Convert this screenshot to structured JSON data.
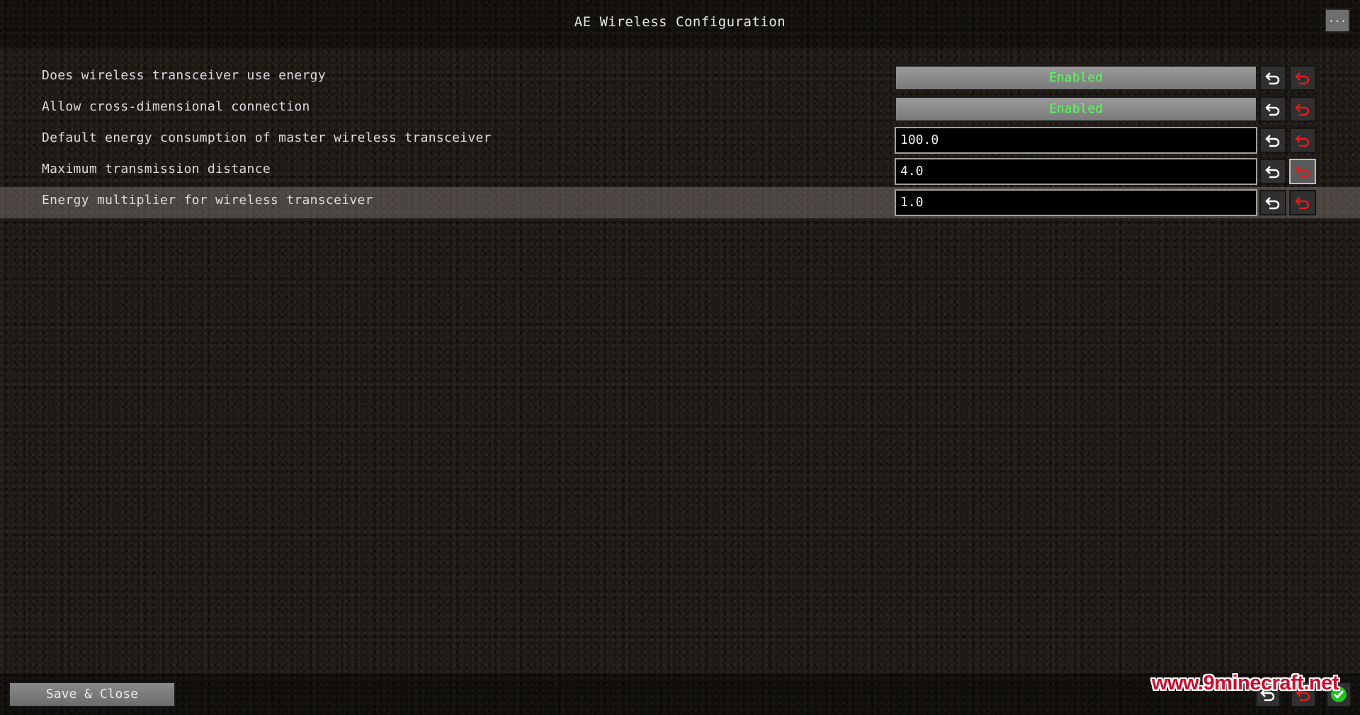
{
  "window": {
    "title": "AE Wireless Configuration",
    "more_label": "..."
  },
  "options": [
    {
      "label": "Does wireless transceiver use energy",
      "type": "toggle",
      "value": "Enabled"
    },
    {
      "label": "Allow cross-dimensional connection",
      "type": "toggle",
      "value": "Enabled"
    },
    {
      "label": "Default energy consumption of master wireless transceiver",
      "type": "number",
      "value": "100.0"
    },
    {
      "label": "Maximum transmission distance",
      "type": "number",
      "value": "4.0"
    },
    {
      "label": "Energy multiplier for wireless transceiver",
      "type": "number",
      "value": "1.0"
    }
  ],
  "footer": {
    "save_label": "Save & Close"
  },
  "watermark": "www.9minecraft.net",
  "colors": {
    "enabled_text": "#55ff55",
    "reset_icon": "#e01c1c",
    "undo_icon": "#ffffff",
    "check_icon": "#22c022"
  },
  "icons": {
    "undo": "undo-arrow-icon",
    "reset": "reset-arrow-icon",
    "check": "checkmark-icon"
  }
}
